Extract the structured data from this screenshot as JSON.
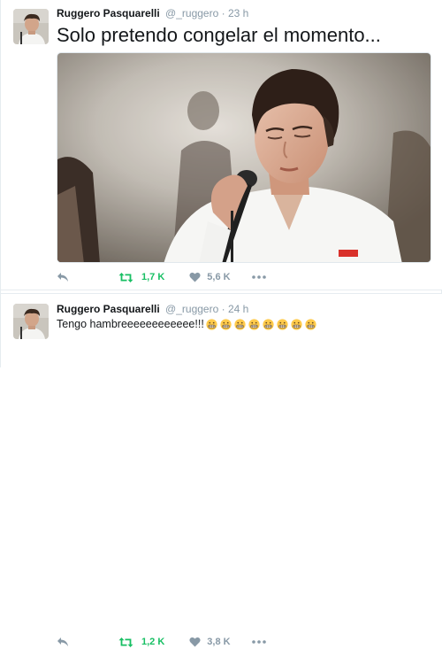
{
  "tweets": [
    {
      "author": {
        "name": "Ruggero Pasquarelli",
        "handle": "@_ruggero"
      },
      "separator": "·",
      "time": "23 h",
      "text": "Solo pretendo congelar el momento...",
      "retweets": "1,7 K",
      "likes": "5,6 K"
    },
    {
      "author": {
        "name": "Ruggero Pasquarelli",
        "handle": "@_ruggero"
      },
      "separator": "·",
      "time": "24 h",
      "text": "Tengo hambreeeeeeeeeeee!!!",
      "emoji_count": 8,
      "emoji": "grimacing-face-icon",
      "retweets": "1,2 K",
      "likes": "3,8 K"
    }
  ],
  "colors": {
    "retweet_active": "#17bf63",
    "icon_gray": "#8899a6",
    "text": "#14171a",
    "border": "#e6ecf0"
  }
}
